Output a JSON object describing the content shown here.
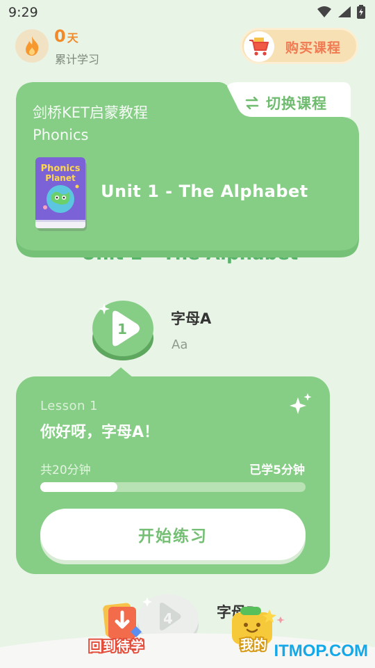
{
  "status_bar": {
    "time": "9:29",
    "icons": [
      "wifi-icon",
      "signal-icon",
      "battery-icon"
    ]
  },
  "streak": {
    "value": "0",
    "unit": "天",
    "label": "累计学习"
  },
  "buy_button": {
    "label": "购买课程",
    "icon": "shopping-cart-icon"
  },
  "course_card": {
    "switch_label": "切换课程",
    "title": "剑桥KET启蒙教程",
    "subtitle": "Phonics",
    "book_cover_text": "Phonics Planet",
    "unit_title": "Unit 1 - The Alphabet"
  },
  "background_unit_title": "Unit 1 - The Alphabet",
  "current_lesson": {
    "node_number": "1",
    "name": "字母A",
    "sub": "Aa"
  },
  "lesson_card": {
    "lesson_number": "Lesson 1",
    "title": "你好呀，字母A！",
    "total_time": "共20分钟",
    "learned_time": "已学5分钟",
    "progress": 0.29,
    "start_label": "开始练习"
  },
  "next_lesson": {
    "node_number": "4",
    "name": "字母D"
  },
  "bottom_nav": {
    "back_label": "回到待学",
    "mine_label": "我的"
  },
  "watermark": "ITMOP.COM",
  "colors": {
    "accent_green": "#86cd86",
    "background": "#e8f4e6",
    "orange": "#f28a2a"
  }
}
